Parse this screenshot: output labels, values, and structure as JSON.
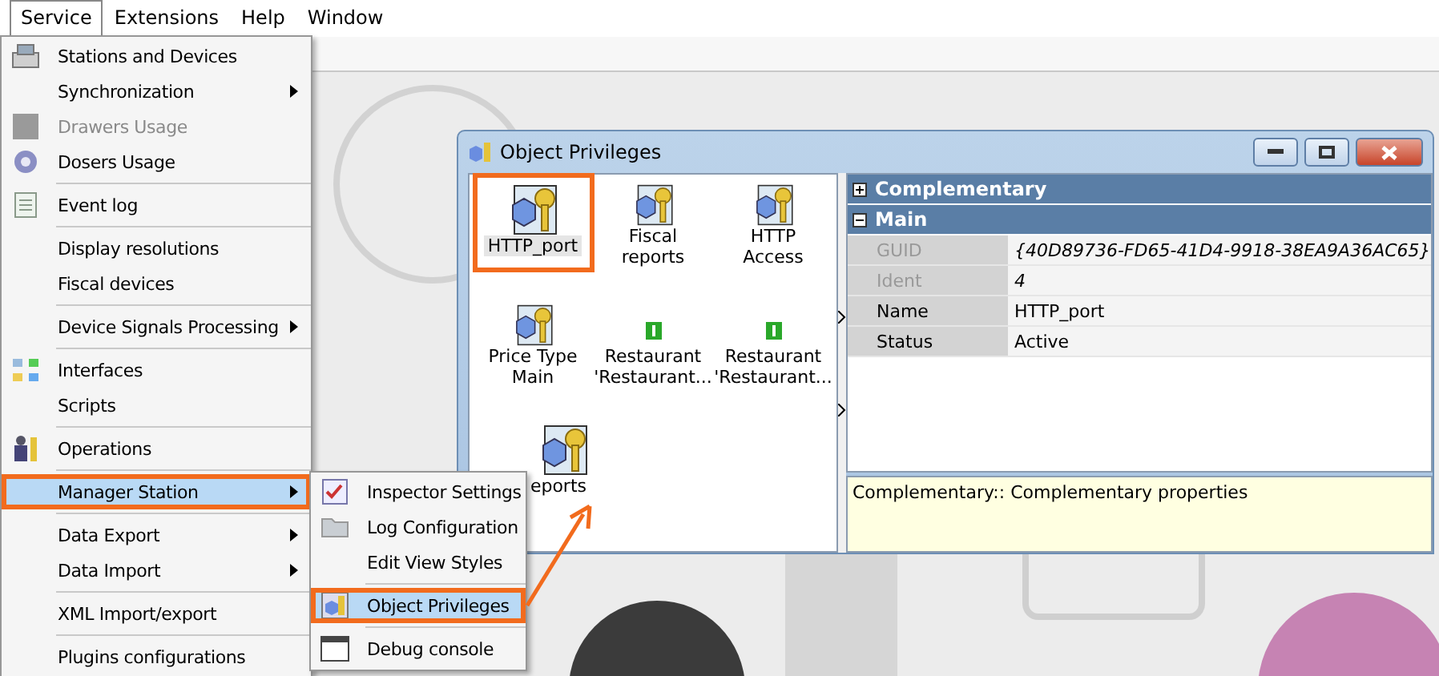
{
  "menu_bar": {
    "items": [
      {
        "label": "Service",
        "selected": true
      },
      {
        "label": "Extensions",
        "selected": false
      },
      {
        "label": "Help",
        "selected": false
      },
      {
        "label": "Window",
        "selected": false
      }
    ]
  },
  "service_menu": {
    "groups": [
      [
        {
          "label": "Stations and Devices",
          "submenu": false,
          "disabled": false,
          "selected": false
        },
        {
          "label": "Synchronization",
          "submenu": true,
          "disabled": false,
          "selected": false
        },
        {
          "label": "Drawers Usage",
          "submenu": false,
          "disabled": true,
          "selected": false
        },
        {
          "label": "Dosers Usage",
          "submenu": false,
          "disabled": false,
          "selected": false
        }
      ],
      [
        {
          "label": "Event log",
          "submenu": false,
          "disabled": false,
          "selected": false
        }
      ],
      [
        {
          "label": "Display resolutions",
          "submenu": false,
          "disabled": false,
          "selected": false
        },
        {
          "label": "Fiscal devices",
          "submenu": false,
          "disabled": false,
          "selected": false
        }
      ],
      [
        {
          "label": "Device Signals Processing",
          "submenu": true,
          "disabled": false,
          "selected": false
        }
      ],
      [
        {
          "label": "Interfaces",
          "submenu": false,
          "disabled": false,
          "selected": false
        },
        {
          "label": "Scripts",
          "submenu": false,
          "disabled": false,
          "selected": false
        }
      ],
      [
        {
          "label": "Operations",
          "submenu": false,
          "disabled": false,
          "selected": false
        }
      ],
      [
        {
          "label": "Manager Station",
          "submenu": true,
          "disabled": false,
          "selected": true
        }
      ],
      [
        {
          "label": "Data Export",
          "submenu": true,
          "disabled": false,
          "selected": false
        },
        {
          "label": "Data Import",
          "submenu": true,
          "disabled": false,
          "selected": false
        }
      ],
      [
        {
          "label": "XML Import/export",
          "submenu": false,
          "disabled": false,
          "selected": false
        }
      ],
      [
        {
          "label": "Plugins configurations",
          "submenu": false,
          "disabled": false,
          "selected": false
        }
      ]
    ]
  },
  "manager_submenu": {
    "groups": [
      [
        {
          "label": "Inspector Settings",
          "selected": false
        },
        {
          "label": "Log Configuration",
          "selected": false
        },
        {
          "label": "Edit View Styles",
          "selected": false
        }
      ],
      [
        {
          "label": "Object Privileges",
          "selected": true
        }
      ],
      [
        {
          "label": "Debug console",
          "selected": false
        }
      ]
    ]
  },
  "dialog": {
    "title": "Object Privileges",
    "objects": [
      {
        "label": "HTTP_port",
        "kind": "key",
        "selected": true
      },
      {
        "label": "Fiscal reports",
        "kind": "key",
        "selected": false
      },
      {
        "label": "HTTP Access",
        "kind": "key",
        "selected": false
      },
      {
        "label": "Price Type Main",
        "kind": "key",
        "selected": false
      },
      {
        "label": "Restaurant 'Restaurant...",
        "kind": "small",
        "selected": false
      },
      {
        "label": "Restaurant 'Restaurant...",
        "kind": "small",
        "selected": false
      },
      {
        "label": "eports",
        "kind": "key",
        "selected": false
      }
    ],
    "categories": [
      {
        "name": "Complementary",
        "expanded": false
      },
      {
        "name": "Main",
        "expanded": true,
        "properties": [
          {
            "name": "GUID",
            "value": "{40D89736-FD65-41D4-9918-38EA9A36AC65}",
            "disabled": true
          },
          {
            "name": "Ident",
            "value": "4",
            "disabled": true
          },
          {
            "name": "Name",
            "value": "HTTP_port",
            "disabled": false
          },
          {
            "name": "Status",
            "value": "Active",
            "disabled": false
          }
        ]
      }
    ],
    "description": "Complementary:: Complementary properties"
  }
}
